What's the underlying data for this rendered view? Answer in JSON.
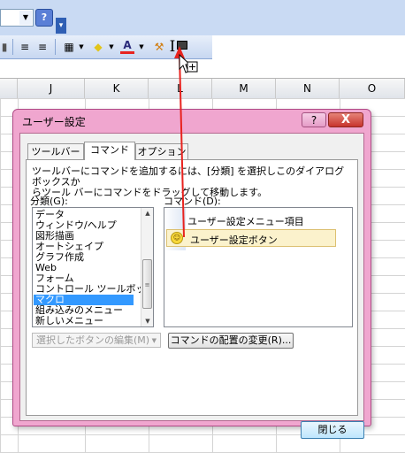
{
  "colors": {
    "accent_red": "#e8231f",
    "dialog_frame": "#f0a6cf",
    "selection": "#3399ff"
  },
  "toolbar": {
    "help_glyph": "?",
    "bold_indent_glyph": "≡",
    "font_color_glyph": "A",
    "cursor_glyph": "I"
  },
  "columns": [
    "J",
    "K",
    "L",
    "M",
    "N",
    "O"
  ],
  "dialog": {
    "title": "ユーザー設定",
    "help_glyph": "?",
    "close_glyph": "X",
    "tabs": [
      "ツールバー",
      "コマンド",
      "オプション"
    ],
    "active_tab": "コマンド",
    "instruction_line1": "ツールバーにコマンドを追加するには、[分類] を選択しこのダイアログ ボックスか",
    "instruction_line2": "らツール バーにコマンドをドラッグして移動します。",
    "categories_label": "分類(G):",
    "categories": [
      "データ",
      "ウィンドウ/ヘルプ",
      "図形描画",
      "オートシェイプ",
      "グラフ作成",
      "Web",
      "フォーム",
      "コントロール ツールボックス",
      "マクロ",
      "組み込みのメニュー",
      "新しいメニュー"
    ],
    "selected_category": "マクロ",
    "commands_label": "コマンド(D):",
    "commands": [
      "ユーザー設定メニュー項目",
      "ユーザー設定ボタン"
    ],
    "selected_command": "ユーザー設定ボタン",
    "modify_button": "選択したボタンの編集(M)",
    "rearrange_button": "コマンドの配置の変更(R)...",
    "close_button": "閉じる"
  }
}
